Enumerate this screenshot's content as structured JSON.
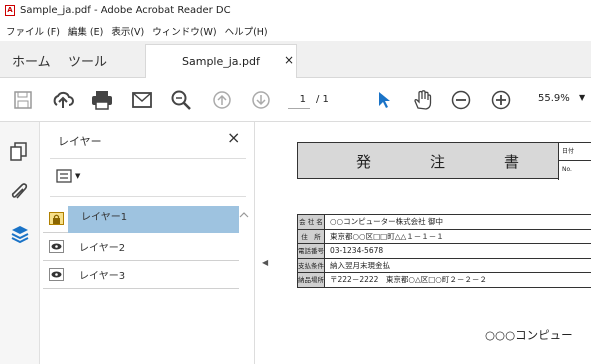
{
  "window": {
    "title": "Sample_ja.pdf - Adobe Acrobat Reader DC"
  },
  "menu": [
    "ファイル (F)",
    "編集 (E)",
    "表示(V)",
    "ウィンドウ(W)",
    "ヘルプ(H)"
  ],
  "tabs": {
    "home": "ホーム",
    "tools": "ツール",
    "doc": "Sample_ja.pdf",
    "close": "×"
  },
  "toolbar": {
    "page_current": "1",
    "page_total": "/ 1",
    "zoom": "55.9%"
  },
  "panel": {
    "title": "レイヤー",
    "close": "×",
    "layers": [
      {
        "label": "レイヤー1",
        "selected": true,
        "locked": true
      },
      {
        "label": "レイヤー2",
        "selected": false,
        "locked": false
      },
      {
        "label": "レイヤー3",
        "selected": false,
        "locked": false
      }
    ]
  },
  "document": {
    "title": "発　注　書",
    "date_label": "日付",
    "no_label": "No.",
    "rows": [
      {
        "key": "会 社 名",
        "value": "○○コンピューター株式会社 御中"
      },
      {
        "key": "住　所",
        "value": "東京都○○区□□町△△１－１－１"
      },
      {
        "key": "電話番号",
        "value": "03-1234-5678"
      },
      {
        "key": "支払条件",
        "value": "納入翌月末現金払"
      },
      {
        "key": "納品場所",
        "value": "〒222－2222　東京都○△区□○町２－２－２"
      }
    ],
    "company_partial": "○○○コンピュー"
  }
}
